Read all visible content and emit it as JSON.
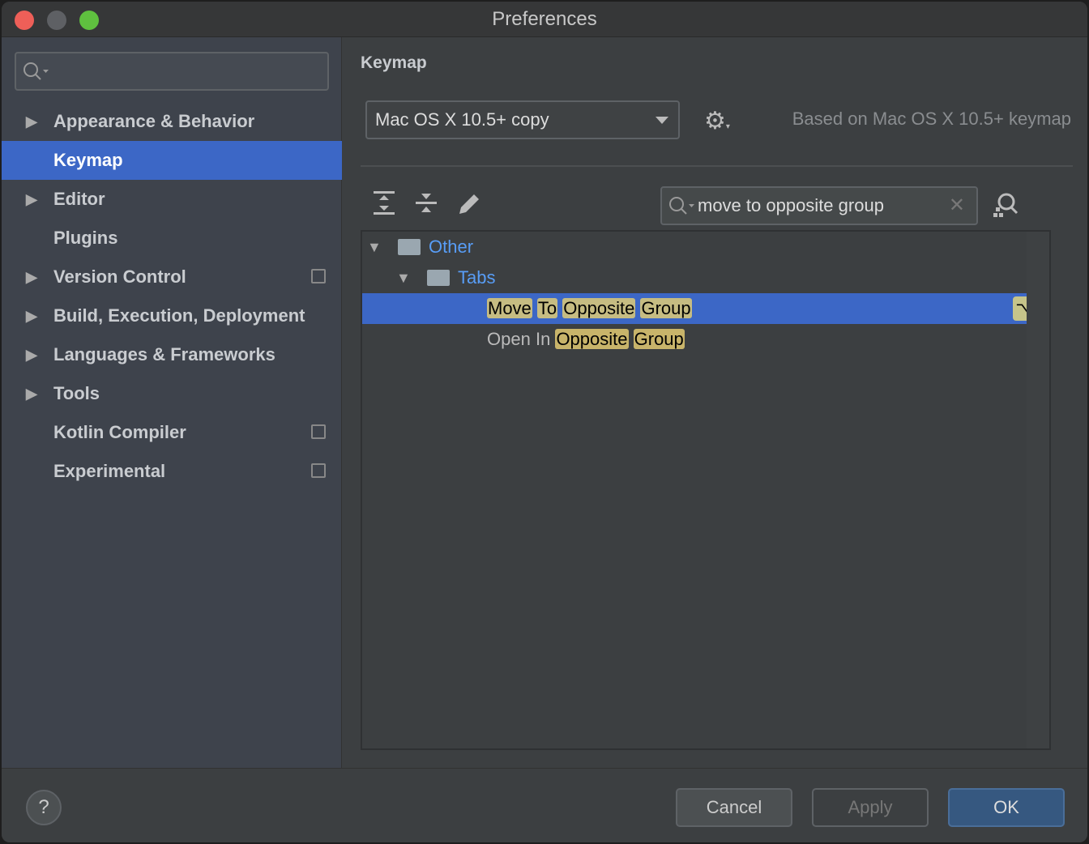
{
  "window": {
    "title": "Preferences"
  },
  "sidebar": {
    "search_placeholder": "",
    "items": [
      {
        "label": "Appearance & Behavior",
        "expandable": true
      },
      {
        "label": "Keymap",
        "selected": true
      },
      {
        "label": "Editor",
        "expandable": true
      },
      {
        "label": "Plugins"
      },
      {
        "label": "Version Control",
        "expandable": true,
        "project": true
      },
      {
        "label": "Build, Execution, Deployment",
        "expandable": true
      },
      {
        "label": "Languages & Frameworks",
        "expandable": true
      },
      {
        "label": "Tools",
        "expandable": true
      },
      {
        "label": "Kotlin Compiler",
        "project": true
      },
      {
        "label": "Experimental",
        "project": true
      }
    ]
  },
  "main": {
    "heading": "Keymap",
    "keymap_value": "Mac OS X 10.5+ copy",
    "based_on": "Based on Mac OS X 10.5+ keymap",
    "filter_value": "move to opposite group",
    "tree": {
      "group": "Other",
      "subgroup": "Tabs",
      "actions": [
        {
          "words": [
            "Move",
            "To",
            "Opposite",
            "Group"
          ],
          "highlighted": [
            true,
            true,
            true,
            true
          ],
          "shortcut": "⌥.",
          "selected": true
        },
        {
          "words": [
            "Open",
            "In",
            "Opposite",
            "Group"
          ],
          "highlighted": [
            false,
            false,
            true,
            true
          ],
          "shortcut": ""
        }
      ]
    }
  },
  "buttons": {
    "help": "?",
    "cancel": "Cancel",
    "apply": "Apply",
    "ok": "OK"
  },
  "colors": {
    "selection": "#3c67c6",
    "highlight": "#c8b46a",
    "link": "#589df6"
  }
}
